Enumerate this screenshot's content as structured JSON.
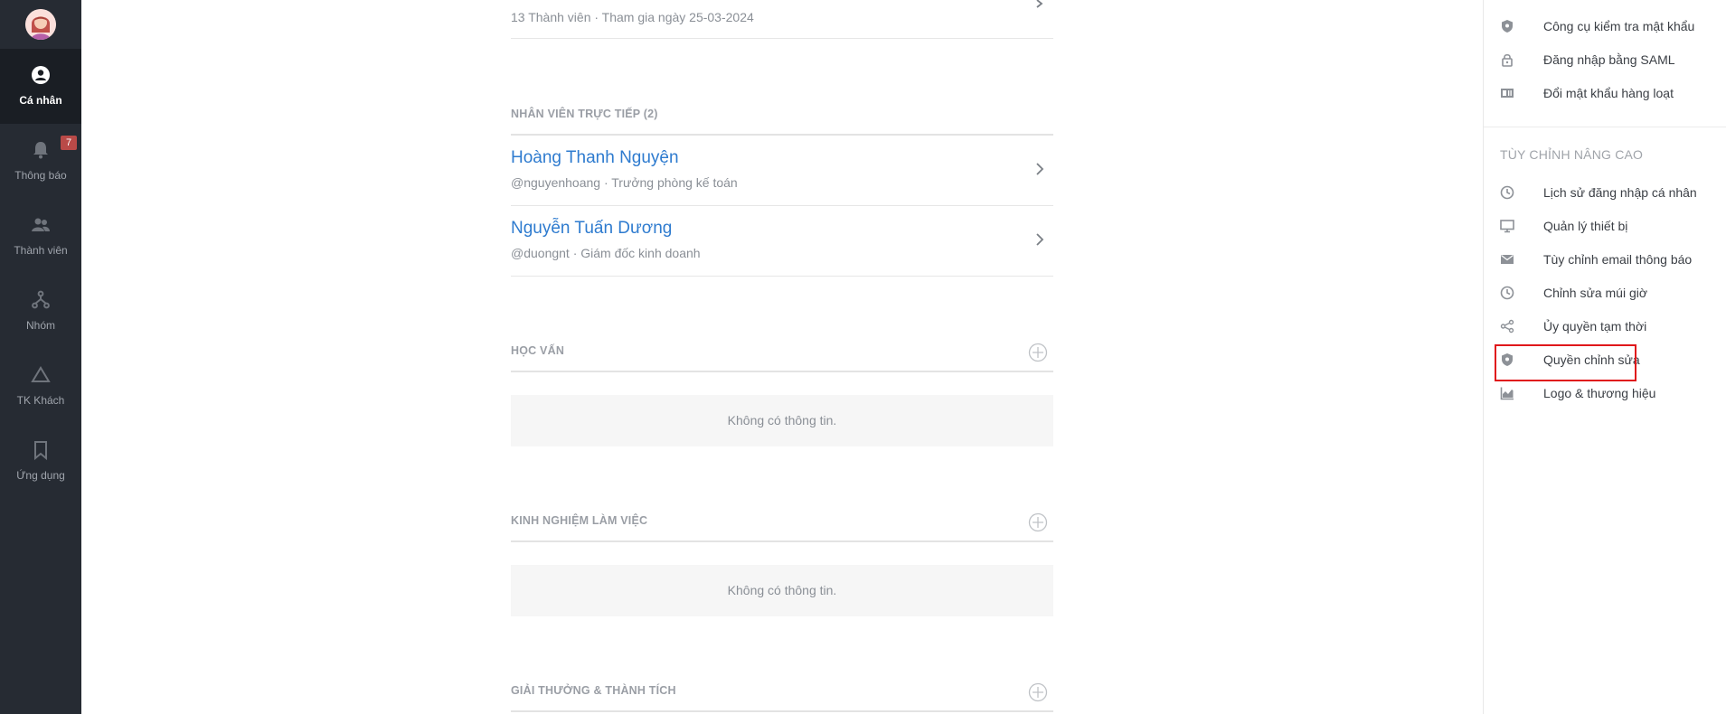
{
  "sidebar": {
    "badge_count": "7",
    "items": [
      {
        "label": "Cá nhân",
        "icon": "user-circle-icon",
        "active": true
      },
      {
        "label": "Thông báo",
        "icon": "bell-icon"
      },
      {
        "label": "Thành viên",
        "icon": "users-icon"
      },
      {
        "label": "Nhóm",
        "icon": "org-chart-icon"
      },
      {
        "label": "TK Khách",
        "icon": "triangle-icon"
      },
      {
        "label": "Ứng dụng",
        "icon": "bookmark-icon"
      }
    ]
  },
  "main": {
    "group_meta": "13 Thành viên · Tham gia ngày 25-03-2024",
    "direct_reports_title": "NHÂN VIÊN TRỰC TIẾP (2)",
    "direct_reports": [
      {
        "name": "Hoàng Thanh Nguyện",
        "desc": "@nguyenhoang · Trưởng phòng kế toán"
      },
      {
        "name": "Nguyễn Tuấn Dương",
        "desc": "@duongnt · Giám đốc kinh doanh"
      }
    ],
    "education_title": "HỌC VẤN",
    "education_empty": "Không có thông tin.",
    "experience_title": "KINH NGHIỆM LÀM VIỆC",
    "experience_empty": "Không có thông tin.",
    "awards_title": "GIẢI THƯỞNG & THÀNH TÍCH"
  },
  "rightpanel": {
    "top_items": [
      {
        "label": "Công cụ kiểm tra mật khẩu",
        "icon": "shield-icon"
      },
      {
        "label": "Đăng nhập bằng SAML",
        "icon": "lock-icon"
      },
      {
        "label": "Đổi mật khẩu hàng loạt",
        "icon": "id-card-icon"
      }
    ],
    "advanced_heading": "TÙY CHỈNH NÂNG CAO",
    "advanced_items": [
      {
        "label": "Lịch sử đăng nhập cá nhân",
        "icon": "clock-icon"
      },
      {
        "label": "Quản lý thiết bị",
        "icon": "monitor-icon"
      },
      {
        "label": "Tùy chỉnh email thông báo",
        "icon": "mail-icon"
      },
      {
        "label": "Chỉnh sửa múi giờ",
        "icon": "clock-icon"
      },
      {
        "label": "Ủy quyền tạm thời",
        "icon": "share-icon"
      },
      {
        "label": "Quyền chỉnh sửa",
        "icon": "shield-icon"
      },
      {
        "label": "Logo & thương hiệu",
        "icon": "chart-area-icon"
      }
    ]
  },
  "colors": {
    "sidebar_bg": "#262b33",
    "link_blue": "#2e7bcf",
    "badge_red": "#b94a48",
    "highlight_red": "#e0171b"
  }
}
